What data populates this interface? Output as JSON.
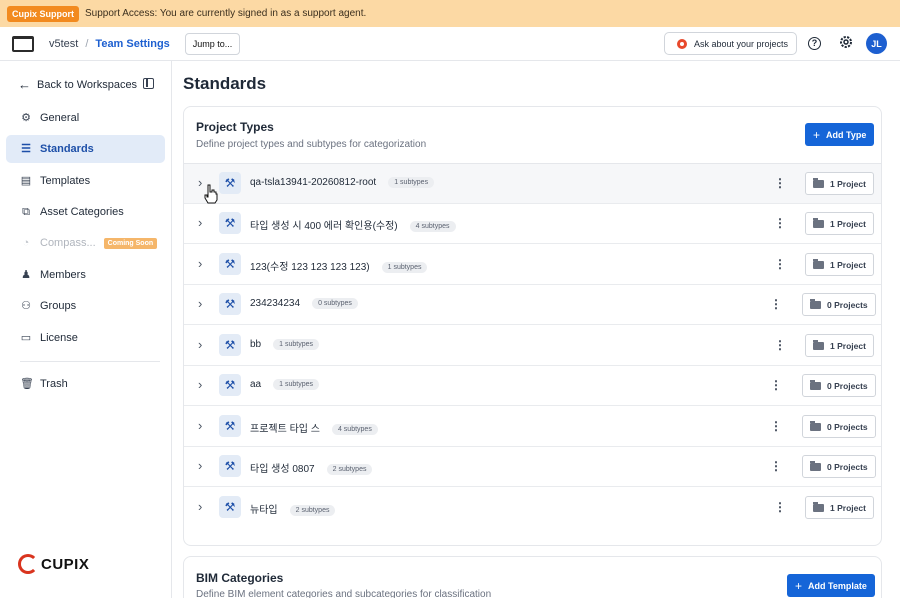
{
  "banner": {
    "badge": "Cupix Support",
    "message": "Support Access: You are currently signed in as a support agent."
  },
  "header": {
    "workspace": "v5test",
    "separator": "/",
    "current": "Team Settings",
    "jump_label": "Jump to...",
    "ask_label": "Ask about your projects",
    "help_glyph": "?",
    "avatar_initials": "JL"
  },
  "sidebar": {
    "back_label": "Back to Workspaces",
    "items": [
      {
        "label": "General",
        "icon": "gear-icon",
        "glyph": "⚙"
      },
      {
        "label": "Standards",
        "icon": "sliders-icon",
        "glyph": "☰"
      },
      {
        "label": "Templates",
        "icon": "document-icon",
        "glyph": "▤"
      },
      {
        "label": "Asset Categories",
        "icon": "hierarchy-icon",
        "glyph": "⧉"
      },
      {
        "label": "Compass...",
        "icon": "compass-icon",
        "glyph": "◔",
        "badge": "Coming Soon"
      },
      {
        "label": "Members",
        "icon": "person-icon",
        "glyph": "♟"
      },
      {
        "label": "Groups",
        "icon": "group-icon",
        "glyph": "⚇"
      },
      {
        "label": "License",
        "icon": "license-icon",
        "glyph": "▭"
      },
      {
        "label": "Trash",
        "icon": "trash-icon",
        "glyph": "🗑"
      }
    ],
    "logo_text": "CUPIX"
  },
  "main": {
    "title": "Standards",
    "project_types": {
      "title": "Project Types",
      "subtitle": "Define project types and subtypes for categorization",
      "add_label": "Add Type",
      "rows": [
        {
          "name": "qa-tsla13941-20260812-root",
          "subtypes": "1 subtypes",
          "projects": "1 Project"
        },
        {
          "name": "타입 생성 시 400 에러 확인용(수정)",
          "subtypes": "4 subtypes",
          "projects": "1 Project"
        },
        {
          "name": "123(수정 123 123 123 123)",
          "subtypes": "1 subtypes",
          "projects": "1 Project"
        },
        {
          "name": "234234234",
          "subtypes": "0 subtypes",
          "projects": "0 Projects"
        },
        {
          "name": "bb",
          "subtypes": "1 subtypes",
          "projects": "1 Project"
        },
        {
          "name": "aa",
          "subtypes": "1 subtypes",
          "projects": "0 Projects"
        },
        {
          "name": "프로젝트 타입 스",
          "subtypes": "4 subtypes",
          "projects": "0 Projects"
        },
        {
          "name": "타입 생성 0807",
          "subtypes": "2 subtypes",
          "projects": "0 Projects"
        },
        {
          "name": "뉴타입",
          "subtypes": "2 subtypes",
          "projects": "1 Project"
        }
      ]
    },
    "bim_categories": {
      "title": "BIM Categories",
      "subtitle": "Define BIM element categories and subcategories for classification",
      "add_label": "Add Template"
    }
  },
  "colors": {
    "accent": "#1565d8",
    "banner": "#fcd9a4",
    "badge": "#f28a1f",
    "active_nav": "#e2ebf8"
  }
}
